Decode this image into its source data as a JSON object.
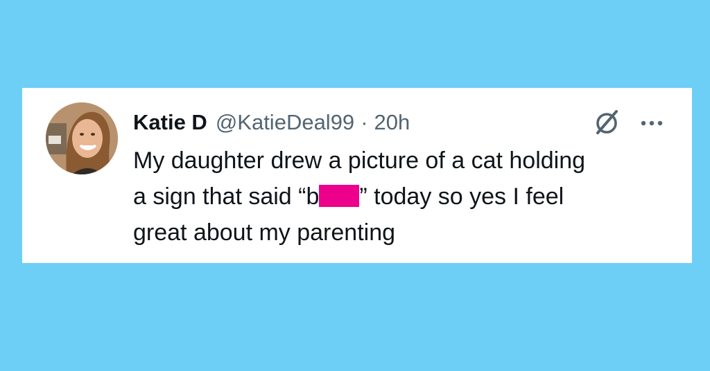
{
  "colors": {
    "background": "#6dcff5",
    "card": "#ffffff",
    "text_primary": "#0f1419",
    "text_secondary": "#536471",
    "censor_block": "#ec008c"
  },
  "tweet": {
    "author_name": "Katie D",
    "handle": "@KatieDeal99",
    "separator": "·",
    "timestamp": "20h",
    "text_line1": "My daughter drew a picture of a cat holding",
    "text_line2_before": "a sign that said “b",
    "text_line2_after": "” today so yes I feel",
    "text_line3": "great about my parenting"
  },
  "icons": {
    "grok": "grok-icon",
    "more": "more-options-icon",
    "avatar": "profile-photo"
  }
}
